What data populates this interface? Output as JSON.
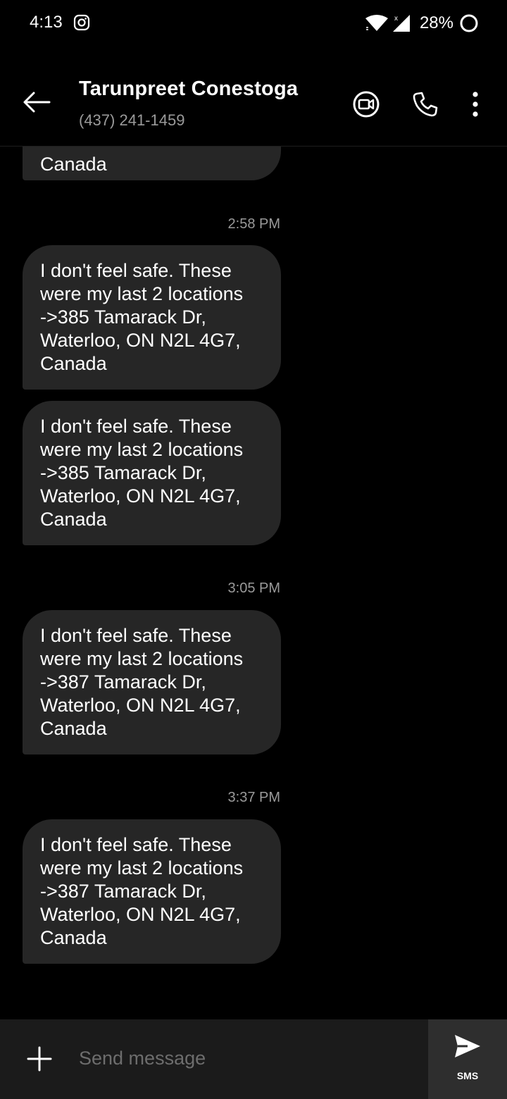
{
  "status_bar": {
    "time": "4:13",
    "battery": "28%",
    "icons": [
      "instagram-icon",
      "wifi-icon",
      "signal-icon",
      "battery-icon"
    ]
  },
  "header": {
    "contact_name": "Tarunpreet Conestoga",
    "contact_phone": "(437) 241-1459",
    "icons": [
      "back-arrow-icon",
      "video-call-icon",
      "phone-icon",
      "more-vert-icon"
    ]
  },
  "messages": [
    {
      "type": "text",
      "text": "Canada",
      "partial": true
    },
    {
      "type": "time",
      "text": "2:58 PM"
    },
    {
      "type": "text",
      "text": "I don't feel safe. These\nwere my last 2 locations\n->385 Tamarack Dr,\nWaterloo, ON N2L 4G7,\nCanada"
    },
    {
      "type": "text",
      "text": "I don't feel safe. These\nwere my last 2 locations\n->385 Tamarack Dr,\nWaterloo, ON N2L 4G7,\nCanada"
    },
    {
      "type": "time",
      "text": "3:05 PM"
    },
    {
      "type": "text",
      "text": "I don't feel safe. These\nwere my last 2 locations\n->387 Tamarack Dr,\nWaterloo, ON N2L 4G7,\nCanada"
    },
    {
      "type": "time",
      "text": "3:37 PM"
    },
    {
      "type": "text",
      "text": "I don't feel safe. These\nwere my last 2 locations\n->387 Tamarack Dr,\nWaterloo, ON N2L 4G7,\nCanada"
    }
  ],
  "composer": {
    "placeholder": "Send message",
    "send_label": "SMS"
  },
  "colors": {
    "background": "#000000",
    "bubble": "#262626",
    "secondary_text": "#9a9a9a",
    "composer": "#1b1b1b",
    "send_button": "#2e2e2e"
  }
}
